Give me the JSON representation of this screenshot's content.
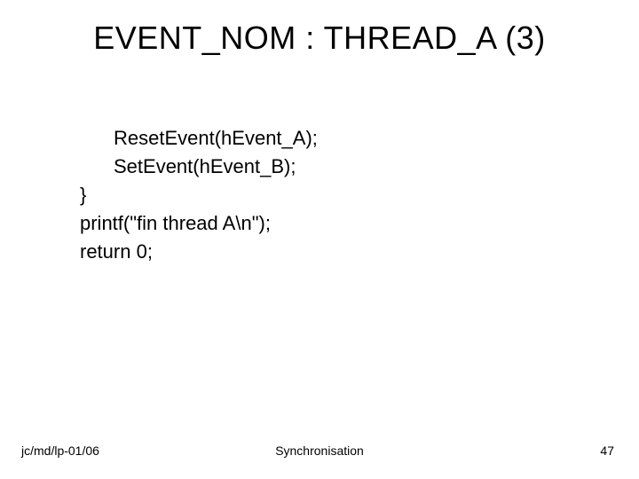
{
  "title": "EVENT_NOM : THREAD_A (3)",
  "code": {
    "line1": "ResetEvent(hEvent_A);",
    "line2": "SetEvent(hEvent_B);",
    "line3": "}",
    "line4": "printf(\"fin thread A\\n\");",
    "line5": "return 0;"
  },
  "footer": {
    "left": "jc/md/lp-01/06",
    "center": "Synchronisation",
    "right": "47"
  }
}
